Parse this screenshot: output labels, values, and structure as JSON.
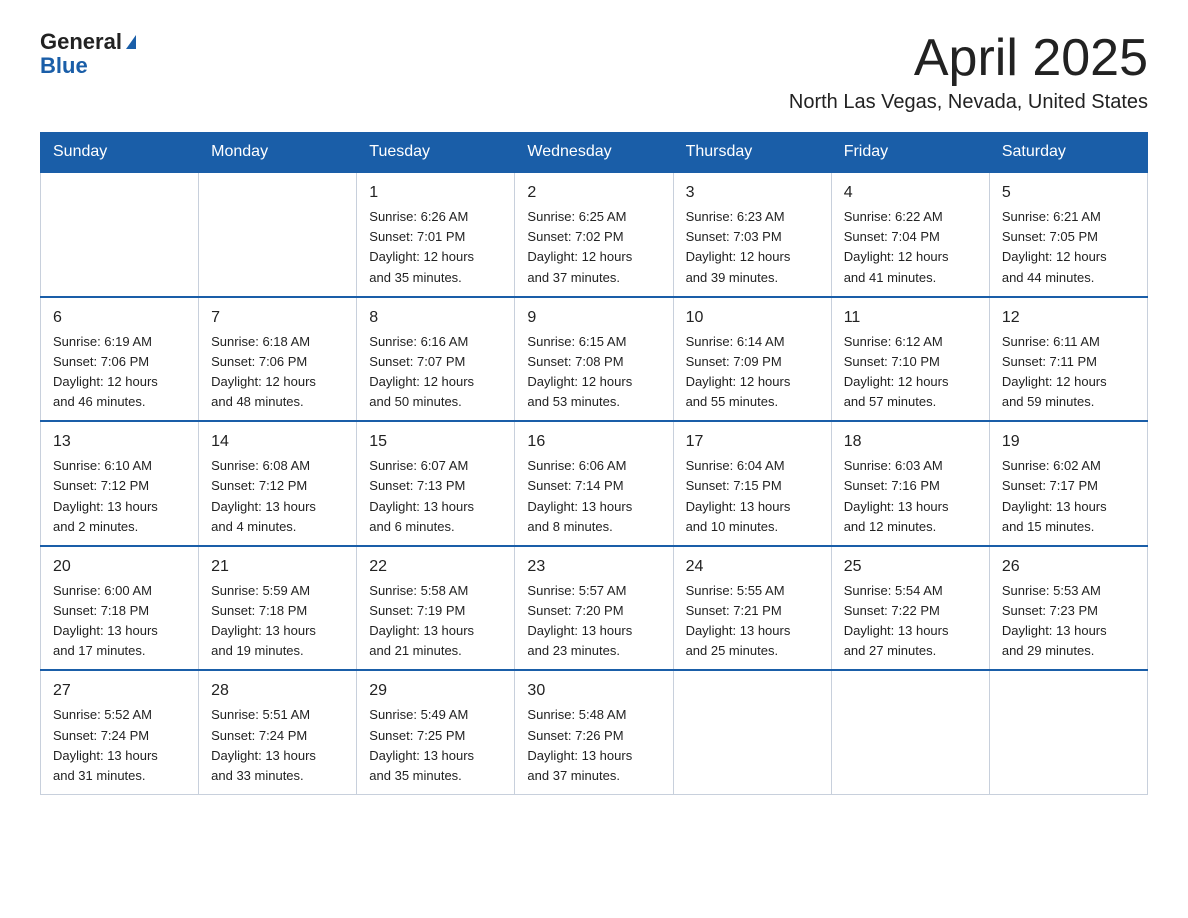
{
  "logo": {
    "line1": "General",
    "line2": "Blue"
  },
  "title": "April 2025",
  "subtitle": "North Las Vegas, Nevada, United States",
  "days_of_week": [
    "Sunday",
    "Monday",
    "Tuesday",
    "Wednesday",
    "Thursday",
    "Friday",
    "Saturday"
  ],
  "weeks": [
    [
      {
        "day": "",
        "info": ""
      },
      {
        "day": "",
        "info": ""
      },
      {
        "day": "1",
        "info": "Sunrise: 6:26 AM\nSunset: 7:01 PM\nDaylight: 12 hours\nand 35 minutes."
      },
      {
        "day": "2",
        "info": "Sunrise: 6:25 AM\nSunset: 7:02 PM\nDaylight: 12 hours\nand 37 minutes."
      },
      {
        "day": "3",
        "info": "Sunrise: 6:23 AM\nSunset: 7:03 PM\nDaylight: 12 hours\nand 39 minutes."
      },
      {
        "day": "4",
        "info": "Sunrise: 6:22 AM\nSunset: 7:04 PM\nDaylight: 12 hours\nand 41 minutes."
      },
      {
        "day": "5",
        "info": "Sunrise: 6:21 AM\nSunset: 7:05 PM\nDaylight: 12 hours\nand 44 minutes."
      }
    ],
    [
      {
        "day": "6",
        "info": "Sunrise: 6:19 AM\nSunset: 7:06 PM\nDaylight: 12 hours\nand 46 minutes."
      },
      {
        "day": "7",
        "info": "Sunrise: 6:18 AM\nSunset: 7:06 PM\nDaylight: 12 hours\nand 48 minutes."
      },
      {
        "day": "8",
        "info": "Sunrise: 6:16 AM\nSunset: 7:07 PM\nDaylight: 12 hours\nand 50 minutes."
      },
      {
        "day": "9",
        "info": "Sunrise: 6:15 AM\nSunset: 7:08 PM\nDaylight: 12 hours\nand 53 minutes."
      },
      {
        "day": "10",
        "info": "Sunrise: 6:14 AM\nSunset: 7:09 PM\nDaylight: 12 hours\nand 55 minutes."
      },
      {
        "day": "11",
        "info": "Sunrise: 6:12 AM\nSunset: 7:10 PM\nDaylight: 12 hours\nand 57 minutes."
      },
      {
        "day": "12",
        "info": "Sunrise: 6:11 AM\nSunset: 7:11 PM\nDaylight: 12 hours\nand 59 minutes."
      }
    ],
    [
      {
        "day": "13",
        "info": "Sunrise: 6:10 AM\nSunset: 7:12 PM\nDaylight: 13 hours\nand 2 minutes."
      },
      {
        "day": "14",
        "info": "Sunrise: 6:08 AM\nSunset: 7:12 PM\nDaylight: 13 hours\nand 4 minutes."
      },
      {
        "day": "15",
        "info": "Sunrise: 6:07 AM\nSunset: 7:13 PM\nDaylight: 13 hours\nand 6 minutes."
      },
      {
        "day": "16",
        "info": "Sunrise: 6:06 AM\nSunset: 7:14 PM\nDaylight: 13 hours\nand 8 minutes."
      },
      {
        "day": "17",
        "info": "Sunrise: 6:04 AM\nSunset: 7:15 PM\nDaylight: 13 hours\nand 10 minutes."
      },
      {
        "day": "18",
        "info": "Sunrise: 6:03 AM\nSunset: 7:16 PM\nDaylight: 13 hours\nand 12 minutes."
      },
      {
        "day": "19",
        "info": "Sunrise: 6:02 AM\nSunset: 7:17 PM\nDaylight: 13 hours\nand 15 minutes."
      }
    ],
    [
      {
        "day": "20",
        "info": "Sunrise: 6:00 AM\nSunset: 7:18 PM\nDaylight: 13 hours\nand 17 minutes."
      },
      {
        "day": "21",
        "info": "Sunrise: 5:59 AM\nSunset: 7:18 PM\nDaylight: 13 hours\nand 19 minutes."
      },
      {
        "day": "22",
        "info": "Sunrise: 5:58 AM\nSunset: 7:19 PM\nDaylight: 13 hours\nand 21 minutes."
      },
      {
        "day": "23",
        "info": "Sunrise: 5:57 AM\nSunset: 7:20 PM\nDaylight: 13 hours\nand 23 minutes."
      },
      {
        "day": "24",
        "info": "Sunrise: 5:55 AM\nSunset: 7:21 PM\nDaylight: 13 hours\nand 25 minutes."
      },
      {
        "day": "25",
        "info": "Sunrise: 5:54 AM\nSunset: 7:22 PM\nDaylight: 13 hours\nand 27 minutes."
      },
      {
        "day": "26",
        "info": "Sunrise: 5:53 AM\nSunset: 7:23 PM\nDaylight: 13 hours\nand 29 minutes."
      }
    ],
    [
      {
        "day": "27",
        "info": "Sunrise: 5:52 AM\nSunset: 7:24 PM\nDaylight: 13 hours\nand 31 minutes."
      },
      {
        "day": "28",
        "info": "Sunrise: 5:51 AM\nSunset: 7:24 PM\nDaylight: 13 hours\nand 33 minutes."
      },
      {
        "day": "29",
        "info": "Sunrise: 5:49 AM\nSunset: 7:25 PM\nDaylight: 13 hours\nand 35 minutes."
      },
      {
        "day": "30",
        "info": "Sunrise: 5:48 AM\nSunset: 7:26 PM\nDaylight: 13 hours\nand 37 minutes."
      },
      {
        "day": "",
        "info": ""
      },
      {
        "day": "",
        "info": ""
      },
      {
        "day": "",
        "info": ""
      }
    ]
  ]
}
